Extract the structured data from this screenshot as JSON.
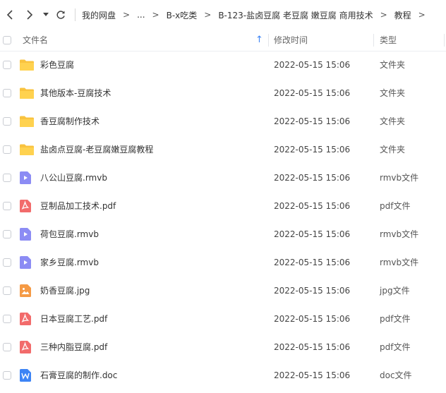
{
  "nav": {
    "breadcrumbs": [
      "我的网盘",
      "...",
      "B-x吃类",
      "B-123-盐卤豆腐 老豆腐 嫩豆腐 商用技术",
      "教程"
    ],
    "separator": ">"
  },
  "header": {
    "name_label": "文件名",
    "modified_label": "修改时间",
    "type_label": "类型",
    "sort_indicator": "↑"
  },
  "colors": {
    "folder": "#F9C33F",
    "video": "#8C8CF4",
    "pdf": "#F26B6B",
    "image": "#F59A45",
    "doc": "#3D84F5"
  },
  "files": [
    {
      "name": "彩色豆腐",
      "modified": "2022-05-15 15:06",
      "type": "文件夹",
      "icon": "folder-icon"
    },
    {
      "name": "其他版本-豆腐技术",
      "modified": "2022-05-15 15:06",
      "type": "文件夹",
      "icon": "folder-icon"
    },
    {
      "name": "香豆腐制作技术",
      "modified": "2022-05-15 15:06",
      "type": "文件夹",
      "icon": "folder-icon"
    },
    {
      "name": "盐卤点豆腐-老豆腐嫩豆腐教程",
      "modified": "2022-05-15 15:06",
      "type": "文件夹",
      "icon": "folder-icon"
    },
    {
      "name": "八公山豆腐.rmvb",
      "modified": "2022-05-15 15:06",
      "type": "rmvb文件",
      "icon": "video-file-icon"
    },
    {
      "name": "豆制品加工技术.pdf",
      "modified": "2022-05-15 15:06",
      "type": "pdf文件",
      "icon": "pdf-file-icon"
    },
    {
      "name": "荷包豆腐.rmvb",
      "modified": "2022-05-15 15:06",
      "type": "rmvb文件",
      "icon": "video-file-icon"
    },
    {
      "name": "家乡豆腐.rmvb",
      "modified": "2022-05-15 15:06",
      "type": "rmvb文件",
      "icon": "video-file-icon"
    },
    {
      "name": "奶香豆腐.jpg",
      "modified": "2022-05-15 15:06",
      "type": "jpg文件",
      "icon": "image-file-icon"
    },
    {
      "name": "日本豆腐工艺.pdf",
      "modified": "2022-05-15 15:06",
      "type": "pdf文件",
      "icon": "pdf-file-icon"
    },
    {
      "name": "三种内脂豆腐.pdf",
      "modified": "2022-05-15 15:06",
      "type": "pdf文件",
      "icon": "pdf-file-icon"
    },
    {
      "name": "石膏豆腐的制作.doc",
      "modified": "2022-05-15 15:06",
      "type": "doc文件",
      "icon": "word-file-icon"
    }
  ]
}
